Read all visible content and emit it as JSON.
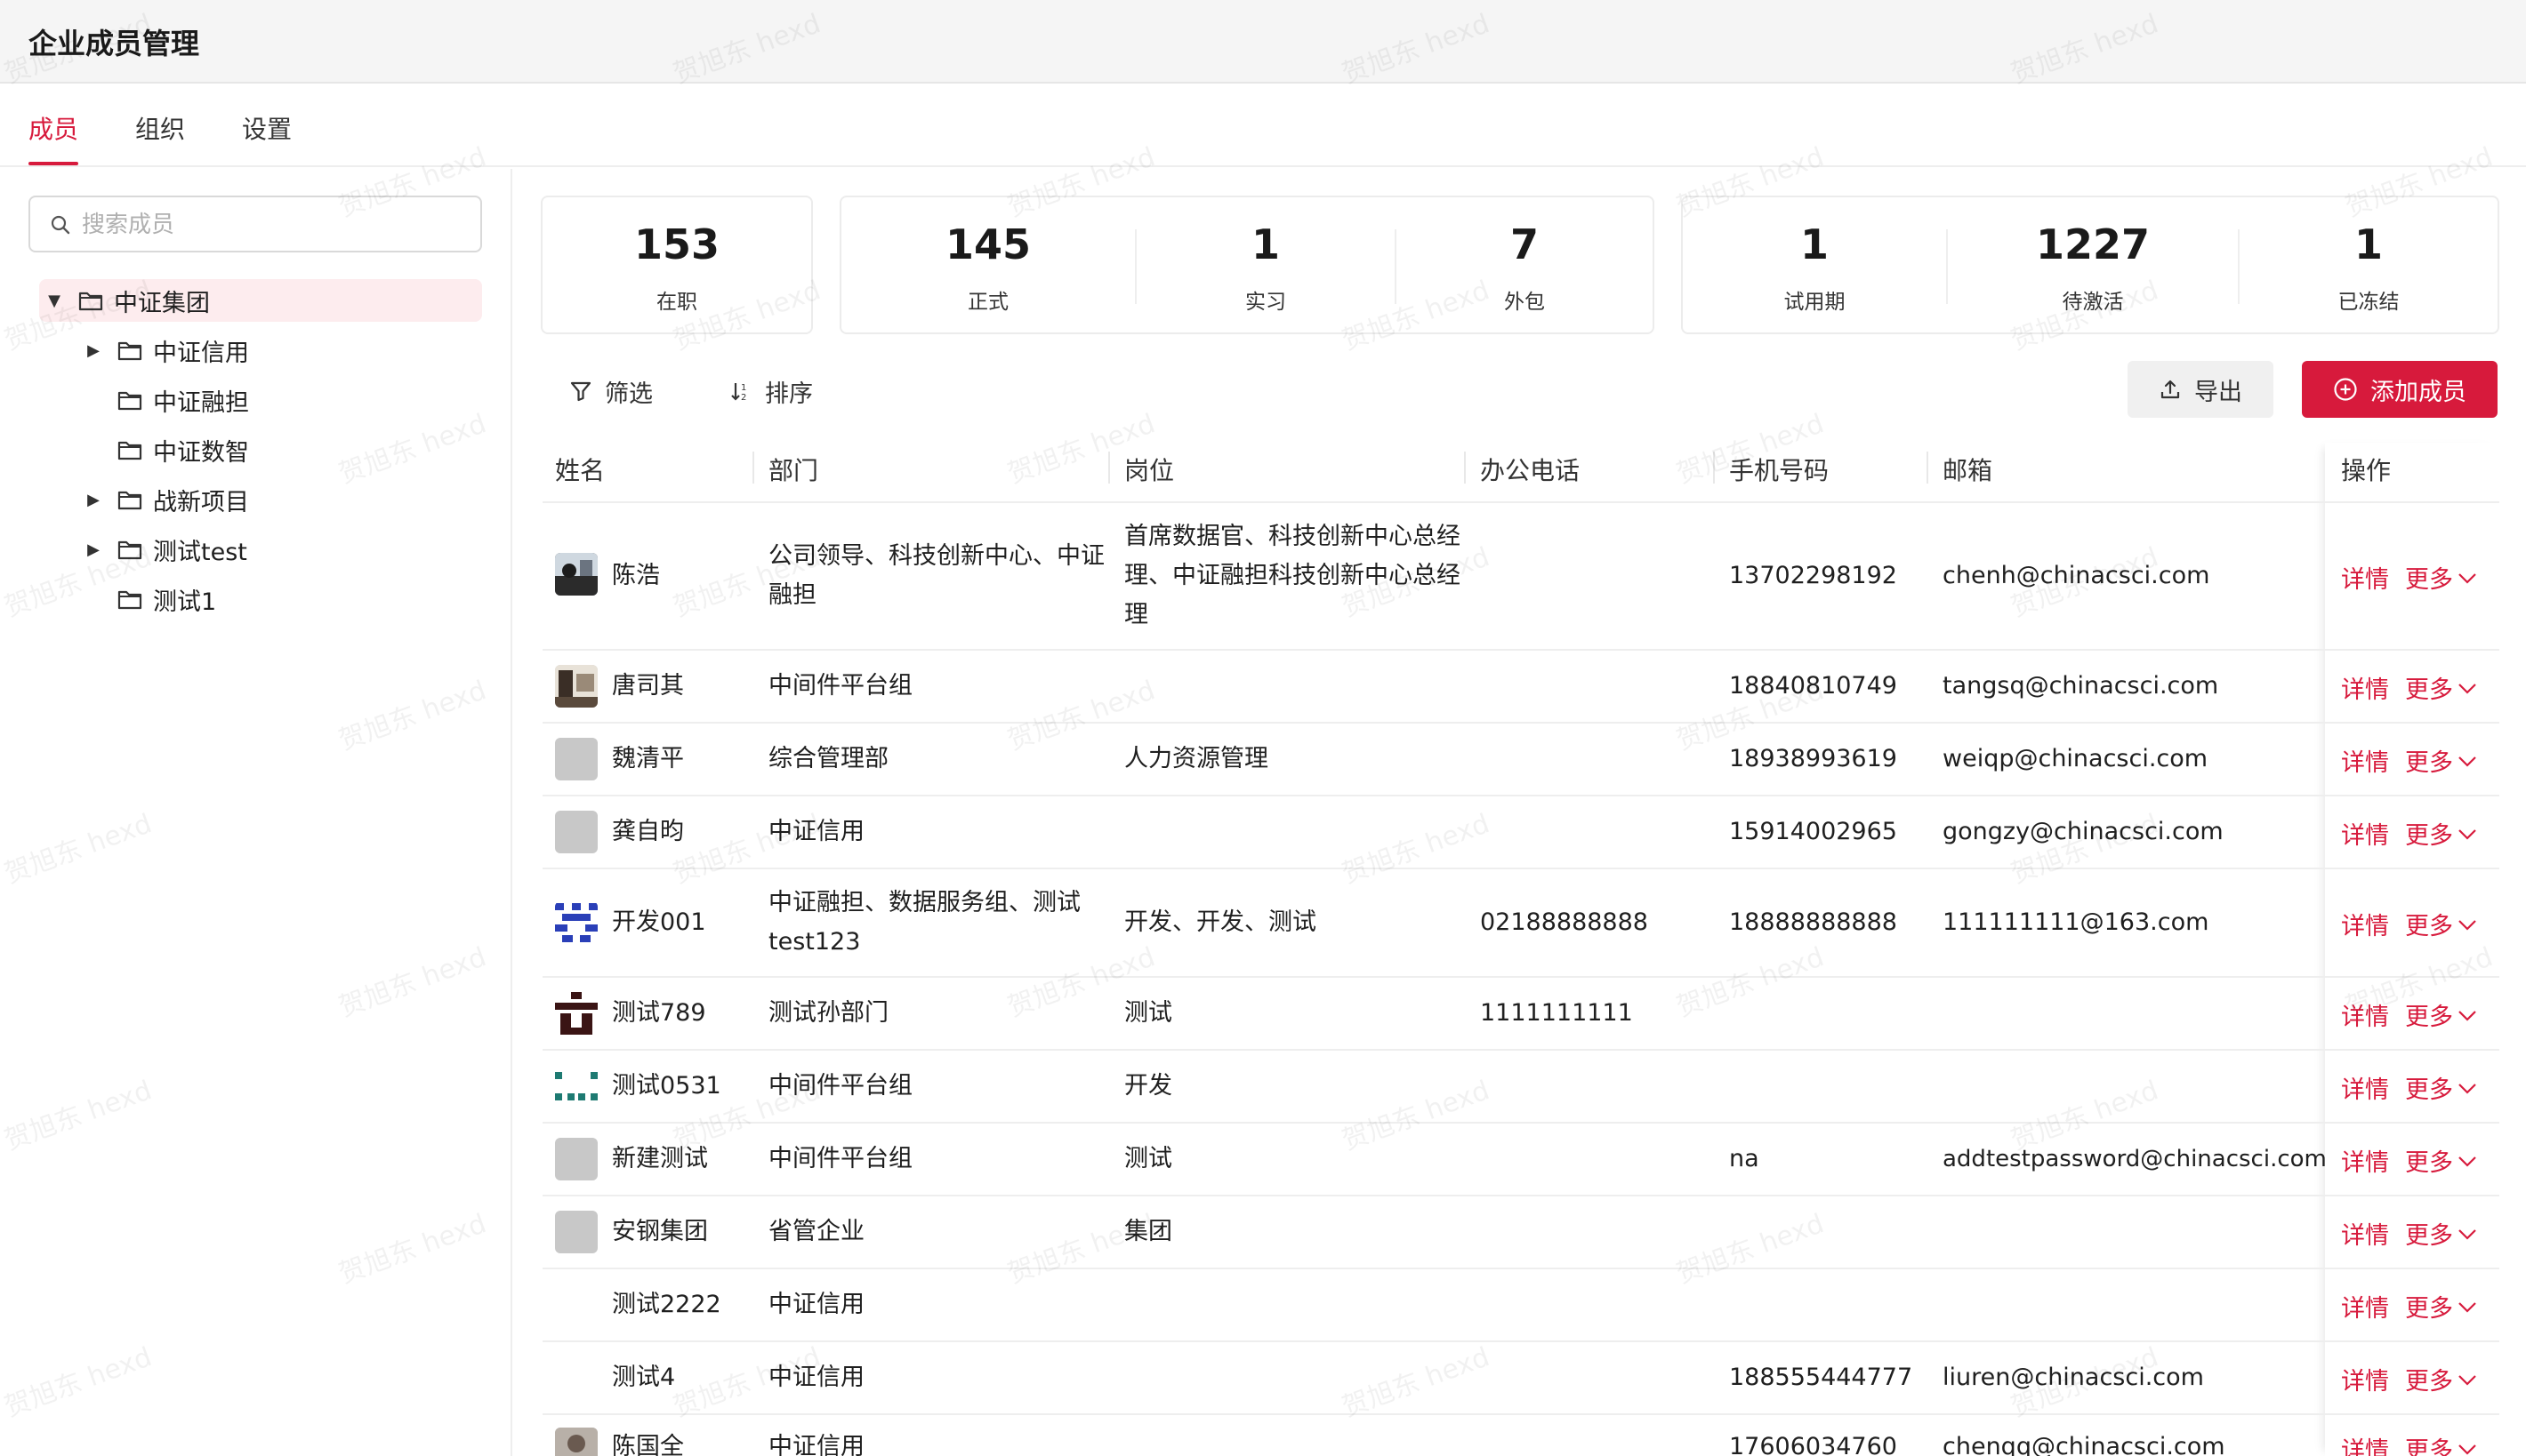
{
  "app": {
    "title": "企业成员管理"
  },
  "tabs": [
    {
      "label": "成员",
      "active": true
    },
    {
      "label": "组织",
      "active": false
    },
    {
      "label": "设置",
      "active": false
    }
  ],
  "search": {
    "placeholder": "搜索成员",
    "value": ""
  },
  "tree": [
    {
      "label": "中证集团",
      "expanded": true,
      "selected": true,
      "level": 0
    },
    {
      "label": "中证信用",
      "has_children": true,
      "level": 1
    },
    {
      "label": "中证融担",
      "has_children": false,
      "level": 1
    },
    {
      "label": "中证数智",
      "has_children": false,
      "level": 1
    },
    {
      "label": "战新项目",
      "has_children": true,
      "level": 1
    },
    {
      "label": "测试test",
      "has_children": true,
      "level": 1
    },
    {
      "label": "测试1",
      "has_children": false,
      "level": 1
    }
  ],
  "stats": [
    {
      "value": "153",
      "label": "在职"
    },
    {
      "value": "145",
      "label": "正式"
    },
    {
      "value": "1",
      "label": "实习"
    },
    {
      "value": "7",
      "label": "外包"
    },
    {
      "value": "1",
      "label": "试用期"
    },
    {
      "value": "1227",
      "label": "待激活"
    },
    {
      "value": "1",
      "label": "已冻结"
    }
  ],
  "toolbar": {
    "filter": "筛选",
    "sort": "排序",
    "export": "导出",
    "add": "添加成员"
  },
  "table": {
    "columns": [
      "姓名",
      "部门",
      "岗位",
      "办公电话",
      "手机号码",
      "邮箱",
      "操作"
    ],
    "action_detail": "详情",
    "action_more": "更多",
    "rows": [
      {
        "name": "陈浩",
        "dept": "公司领导、科技创新中心、中证融担",
        "position": "首席数据官、科技创新中心总经理、中证融担科技创新中心总经理",
        "office": "",
        "mobile": "13702298192",
        "email": "chenh@chinacsci.com",
        "avatar": "photo"
      },
      {
        "name": "唐司其",
        "dept": "中间件平台组",
        "position": "",
        "office": "",
        "mobile": "18840810749",
        "email": "tangsq@chinacsci.com",
        "avatar": "photo"
      },
      {
        "name": "魏清平",
        "dept": "综合管理部",
        "position": "人力资源管理",
        "office": "",
        "mobile": "18938993619",
        "email": "weiqp@chinacsci.com",
        "avatar": "gray"
      },
      {
        "name": "龚自昀",
        "dept": "中证信用",
        "position": "",
        "office": "",
        "mobile": "15914002965",
        "email": "gongzy@chinacsci.com",
        "avatar": "gray"
      },
      {
        "name": "开发001",
        "dept": "中证融担、数据服务组、测试test123",
        "position": "开发、开发、测试",
        "office": "02188888888",
        "mobile": "18888888888",
        "email": "111111111@163.com",
        "avatar": "pattern-blue"
      },
      {
        "name": "测试789",
        "dept": "测试孙部门",
        "position": "测试",
        "office": "1111111111",
        "mobile": "",
        "email": "",
        "avatar": "pattern-dark"
      },
      {
        "name": "测试0531",
        "dept": "中间件平台组",
        "position": "开发",
        "office": "",
        "mobile": "",
        "email": "",
        "avatar": "pattern-teal"
      },
      {
        "name": "新建测试",
        "dept": "中间件平台组",
        "position": "测试",
        "office": "",
        "mobile": "na",
        "email": "addtestpassword@chinacsci.com",
        "avatar": "gray"
      },
      {
        "name": "安钢集团",
        "dept": "省管企业",
        "position": "集团",
        "office": "",
        "mobile": "",
        "email": "",
        "avatar": "gray"
      },
      {
        "name": "测试2222",
        "dept": "中证信用",
        "position": "",
        "office": "",
        "mobile": "",
        "email": "",
        "avatar": "none"
      },
      {
        "name": "测试4",
        "dept": "中证信用",
        "position": "",
        "office": "",
        "mobile": "188555444777",
        "email": "liuren@chinacsci.com",
        "avatar": "none"
      },
      {
        "name": "陈国全",
        "dept": "中证信用",
        "position": "",
        "office": "",
        "mobile": "17606034760",
        "email": "chenqq@chinacsci.com",
        "avatar": "photo"
      }
    ]
  },
  "watermark": "贺旭东 hexd",
  "colors": {
    "accent": "#d71a3c",
    "selected_bg": "#fdecee"
  }
}
